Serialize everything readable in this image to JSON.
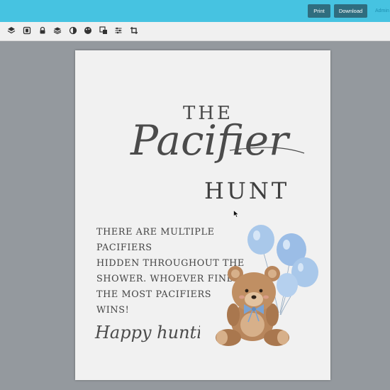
{
  "header": {
    "print_label": "Print",
    "download_label": "Download",
    "admin_label": "Admin"
  },
  "toolbar": {
    "tools": [
      "layers-icon",
      "image-icon",
      "lock-icon",
      "stack-icon",
      "contrast-icon",
      "palette-icon",
      "replace-image-icon",
      "adjust-icon",
      "crop-icon"
    ]
  },
  "document": {
    "title_top": "THE",
    "title_script": "Pacifier",
    "title_bottom": "HUNT",
    "body": "THERE ARE MULTIPLE PACIFIERS\nHIDDEN THROUGHOUT THE\nSHOWER. WHOEVER FINDS\nTHE MOST PACIFIERS\nWINS!",
    "closing": "Happy hunting!"
  },
  "colors": {
    "header": "#46c3e1",
    "button": "#2f6d7f",
    "canvas": "#94999e",
    "paper": "#f1f1f1",
    "balloon": "#a9c8ea",
    "bear": "#b8865c"
  }
}
